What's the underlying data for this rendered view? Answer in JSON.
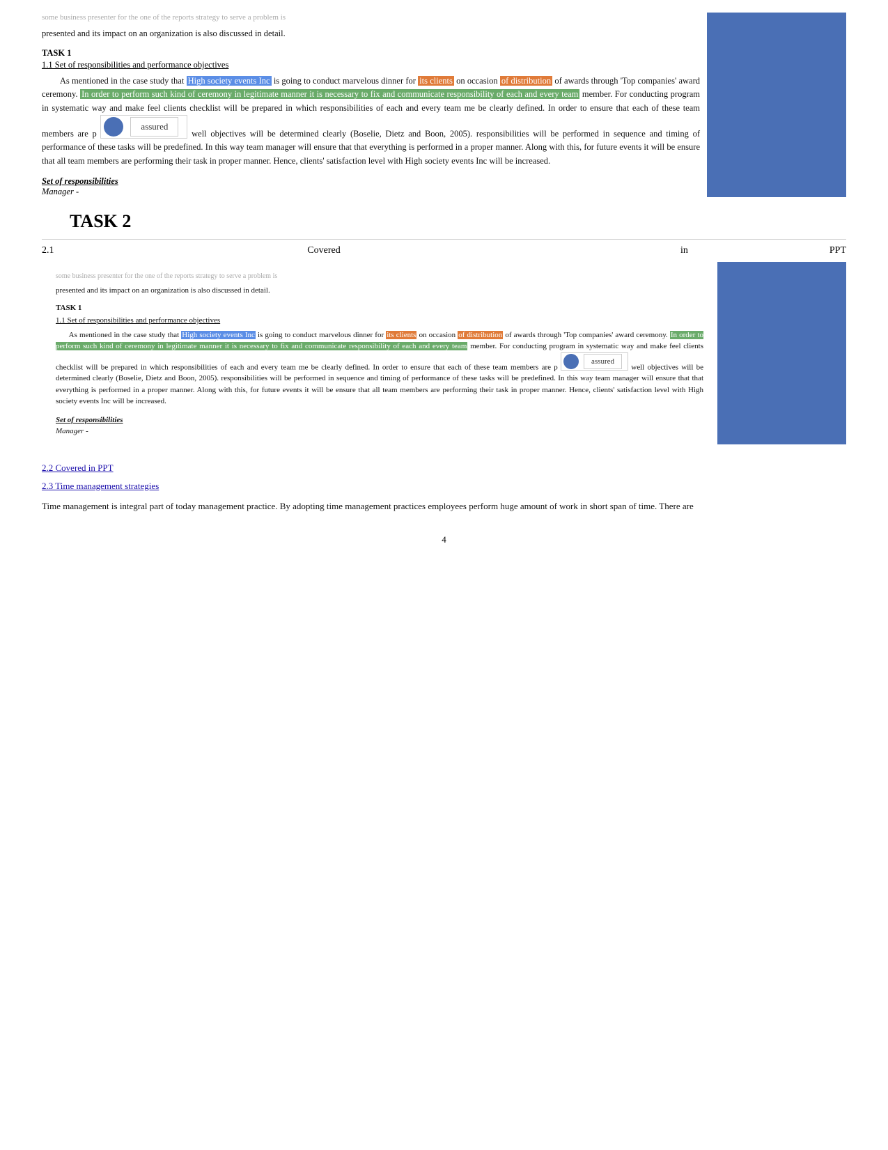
{
  "page": {
    "faded_top": "some business presenter for the one of the reports strategy to serve a problem is",
    "presented_line": "presented and its impact on an organization is also discussed in detail.",
    "task1_label": "TASK 1",
    "sub1_label": "1.1 Set of responsibilities and performance objectives",
    "para1_part1": "As mentioned in the case study that ",
    "para1_high1": "High society events Inc",
    "para1_part2": " is going to conduct marvelous dinner for ",
    "para1_high2": "its clients",
    "para1_part3": " on occasion ",
    "para1_high3": "of distribution",
    "para1_part4": " of awards through 'Top companies' award ceremony. ",
    "para1_high4": "In order to perform such kind of ceremony in legitimate manner it is necessary to fix and communicate responsibility of each and every team",
    "para1_part5": " member. For conducting program in systematic way and make feel clients checklist will be prepared in which responsibilities of each and every team me be clearly defined. In order to ensure that each of these team members are p",
    "assured_text": "assured",
    "para1_part6": " well objectives will be determined clearly (Boselie, Dietz and Boon, 2005). responsibilities will be performed in sequence and timing of performance of these tasks will be predefined.  In this way team manager will ensure that that everything is performed in a proper manner. Along with this, for future events it will be ensure that all team members are performing their task in proper manner. Hence, clients' satisfaction level with High society events Inc will be increased.",
    "set_resp_label": "Set of responsibilities",
    "manager_label": "Manager -",
    "task2_heading": "TASK 2",
    "row_num": "2.1",
    "row_title": "Covered",
    "row_in": "in",
    "row_ppt": "PPT",
    "embedded_faded": "some business presenter for the one of the reports strategy to serve a problem is",
    "embedded_presented": "presented and its impact on an organization is also discussed in detail.",
    "embedded_task1": "TASK 1",
    "embedded_sub1": "1.1 Set of responsibilities and performance objectives",
    "embedded_para1": "As mentioned in the case study that ",
    "embedded_high1": "High society events Inc",
    "embedded_p2": " is going to conduct marvelous dinner for ",
    "embedded_high2": "its clients",
    "embedded_p3": " on occasion ",
    "embedded_high3": "of distribution",
    "embedded_p4": " of awards through 'Top companies' award ceremony. ",
    "embedded_high4": "In order to perform such kind of ceremony in legitimate manner it is necessary to fix and communicate responsibility of each and every team",
    "embedded_p5": " member. For conducting program in systematic way and make feel clients checklist will be prepared in which responsibilities of each and every team me be clearly defined. In order to ensure that each of these team members are p",
    "embedded_assured": "assured",
    "embedded_p6": " well objectives will be determined clearly (Boselie, Dietz and Boon, 2005). responsibilities will be performed in sequence and timing of performance of these tasks will be predefined.  In this way team manager will ensure that that everything is performed in a proper manner. Along with this, for future events it will be ensure that all team members are performing their task in proper manner. Hence, clients' satisfaction level with High society events Inc will be increased.",
    "embedded_set_resp": "Set of responsibilities",
    "embedded_manager": "Manager -",
    "sec22_label": "2.2 Covered in PPT",
    "sec23_label": "2.3 Time management strategies",
    "sec23_para": "Time management is integral part of today management practice.  By adopting time management practices employees perform huge amount of work in short span of time. There are",
    "page_number": "4"
  }
}
